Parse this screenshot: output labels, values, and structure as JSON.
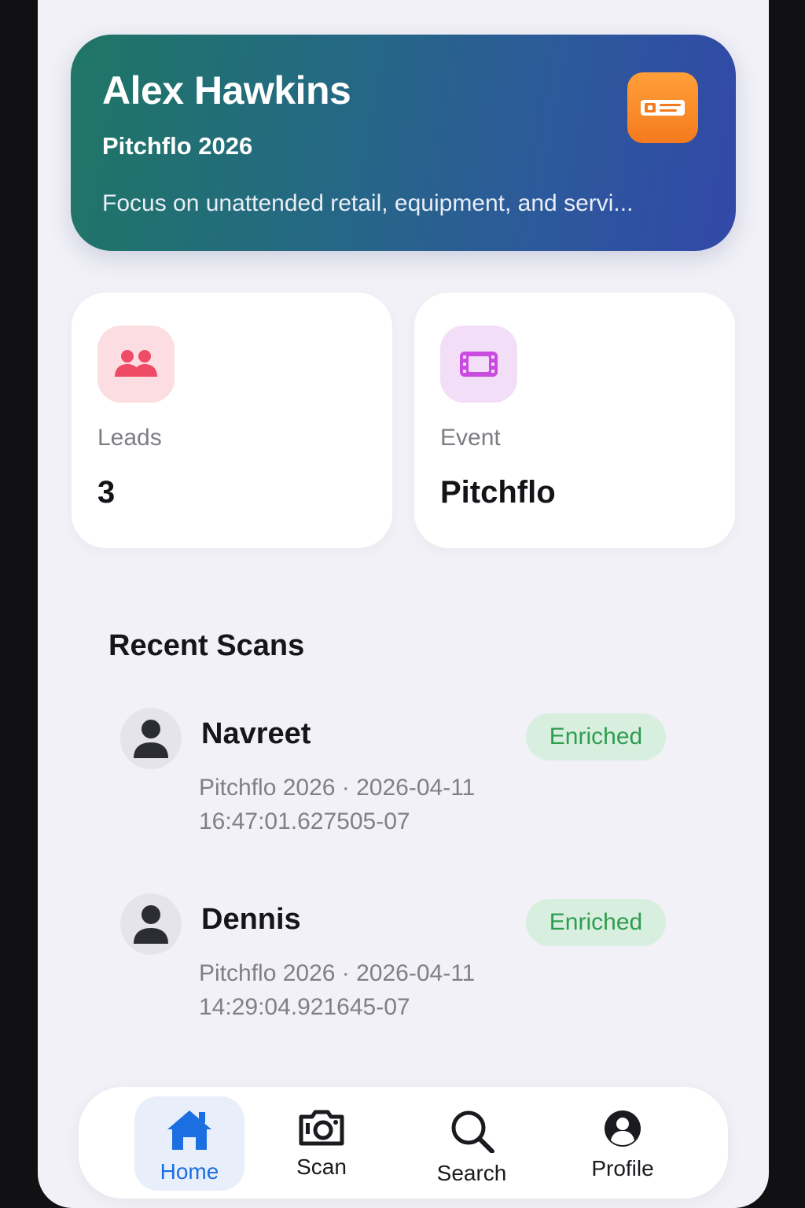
{
  "hero": {
    "name": "Alex Hawkins",
    "event": "Pitchflo 2026",
    "description": "Focus on unattended retail, equipment, and servi...",
    "badge_icon": "id-card-icon",
    "badge_color": "#f7871f"
  },
  "stats": {
    "leads": {
      "label": "Leads",
      "value": "3",
      "icon": "people-icon"
    },
    "event": {
      "label": "Event",
      "value": "Pitchflo",
      "icon": "ticket-icon"
    }
  },
  "recent_scans": {
    "title": "Recent Scans",
    "items": [
      {
        "name": "Navreet",
        "meta_line1": "Pitchflo 2026 · 2026-04-11",
        "meta_line2": "16:47:01.627505-07",
        "status": "Enriched"
      },
      {
        "name": "Dennis",
        "meta_line1": "Pitchflo 2026 · 2026-04-11",
        "meta_line2": "14:29:04.921645-07",
        "status": "Enriched"
      }
    ]
  },
  "tabbar": {
    "tabs": [
      {
        "label": "Home",
        "icon": "home-icon",
        "active": true
      },
      {
        "label": "Scan",
        "icon": "camera-icon",
        "active": false
      },
      {
        "label": "Search",
        "icon": "search-icon",
        "active": false
      },
      {
        "label": "Profile",
        "icon": "profile-icon",
        "active": false
      }
    ]
  },
  "colors": {
    "accent": "#1b6fe0",
    "enriched_bg": "#d8efdf",
    "enriched_text": "#2e9d50"
  }
}
